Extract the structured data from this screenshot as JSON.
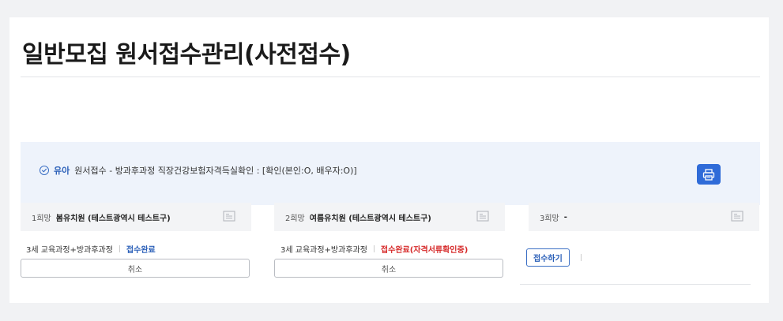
{
  "page": {
    "title": "일반모집 원서접수관리(사전접수)"
  },
  "notice": {
    "child_name": "유아",
    "text": "원서접수 - 방과후과정 직장건강보험자격득실확인 : [확인(본인:O, 배우자:O)]"
  },
  "choices": [
    {
      "rank": "1희망",
      "kindergarten": "봄유치원 (테스트광역시 테스트구)",
      "course": "3세 교육과정+방과후과정",
      "status": "접수완료",
      "status_color": "#2a5fb8",
      "cancel_label": "취소"
    },
    {
      "rank": "2희망",
      "kindergarten": "여름유치원 (테스트광역시 테스트구)",
      "course": "3세 교육과정+방과후과정",
      "status": "접수완료(자격서류확인중)",
      "status_color": "#d62a2a",
      "cancel_label": "취소"
    },
    {
      "rank": "3희망",
      "kindergarten": "-",
      "apply_label": "접수하기"
    }
  ],
  "colors": {
    "accent": "#2f6bd8",
    "notice_bg": "#eef3fb"
  },
  "icons": {
    "notice": "check-circle-icon",
    "print": "printer-icon",
    "choice": "document-icon"
  }
}
